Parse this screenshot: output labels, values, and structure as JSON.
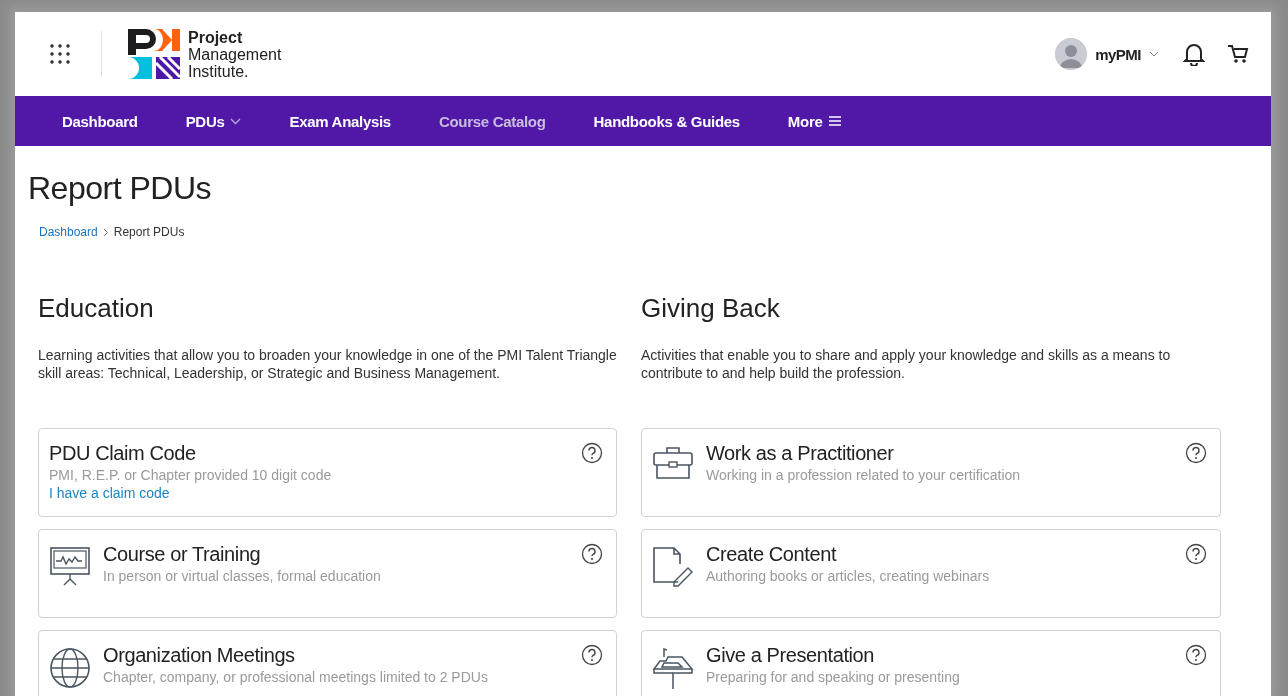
{
  "header": {
    "logo_text": [
      "Project",
      "Management",
      "Institute."
    ],
    "account": "myPMI"
  },
  "nav": [
    {
      "label": "Dashboard",
      "selected": false,
      "dropdown": false
    },
    {
      "label": "PDUs",
      "selected": false,
      "dropdown": true
    },
    {
      "label": "Exam Analysis",
      "selected": false,
      "dropdown": false
    },
    {
      "label": "Course Catalog",
      "selected": true,
      "dropdown": false
    },
    {
      "label": "Handbooks & Guides",
      "selected": false,
      "dropdown": false
    },
    {
      "label": "More",
      "selected": false,
      "dropdown": false,
      "menu": true
    }
  ],
  "page_title": "Report PDUs",
  "breadcrumb": [
    {
      "label": "Dashboard",
      "link": true
    },
    {
      "label": "Report PDUs",
      "link": false
    }
  ],
  "sections": [
    {
      "title": "Education",
      "description": "Learning activities that allow you to broaden your knowledge in one of the PMI Talent Triangle skill areas: Technical, Leadership, or Strategic and Business Management.",
      "cards": [
        {
          "title": "PDU Claim Code",
          "subtitle": "PMI, R.E.P. or Chapter provided 10 digit code",
          "link": "I have a claim code"
        },
        {
          "title": "Course or Training",
          "subtitle": "In person or virtual classes, formal education"
        },
        {
          "title": "Organization Meetings",
          "subtitle": "Chapter, company, or professional meetings limited to 2 PDUs"
        }
      ]
    },
    {
      "title": "Giving Back",
      "description": "Activities that enable you to share and apply your knowledge and skills as a means to contribute to and help build the profession.",
      "cards": [
        {
          "title": "Work as a Practitioner",
          "subtitle": "Working in a profession related to your certification"
        },
        {
          "title": "Create Content",
          "subtitle": "Authoring books or articles, creating webinars"
        },
        {
          "title": "Give a Presentation",
          "subtitle": "Preparing for and speaking or presenting"
        }
      ]
    }
  ]
}
